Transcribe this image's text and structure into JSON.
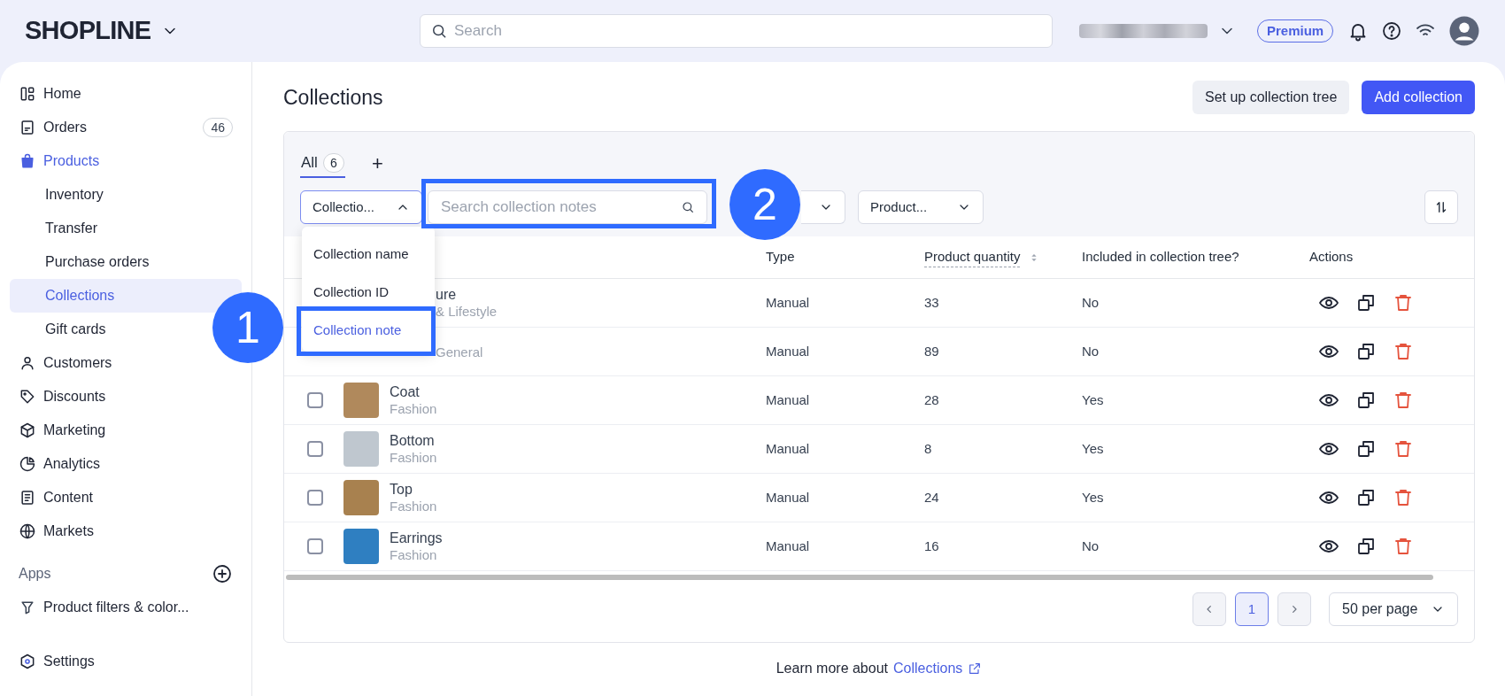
{
  "topbar": {
    "logo": "SHOPLINE",
    "search": {
      "placeholder": "Search"
    },
    "plan_badge": "Premium"
  },
  "sidebar": {
    "items": [
      {
        "label": "Home",
        "selected": false
      },
      {
        "label": "Orders",
        "selected": false,
        "badge": "46"
      },
      {
        "label": "Products",
        "selected": false,
        "expanded": true,
        "children": [
          {
            "label": "Inventory",
            "selected": false
          },
          {
            "label": "Transfer",
            "selected": false
          },
          {
            "label": "Purchase orders",
            "selected": false
          },
          {
            "label": "Collections",
            "selected": true
          },
          {
            "label": "Gift cards",
            "selected": false
          }
        ]
      },
      {
        "label": "Customers",
        "selected": false
      },
      {
        "label": "Discounts",
        "selected": false
      },
      {
        "label": "Marketing",
        "selected": false
      },
      {
        "label": "Analytics",
        "selected": false
      },
      {
        "label": "Content",
        "selected": false
      },
      {
        "label": "Markets",
        "selected": false
      }
    ],
    "apps_heading": "Apps",
    "apps": [
      {
        "label": "Product filters & color..."
      }
    ],
    "settings": "Settings"
  },
  "page": {
    "title": "Collections",
    "buttons": [
      {
        "label": "Set up collection tree",
        "kind": "secondary"
      },
      {
        "label": "Add collection",
        "kind": "primary"
      }
    ]
  },
  "tabs": [
    {
      "label": "All",
      "count": "6",
      "selected": true
    }
  ],
  "add_tab": "+",
  "filters": {
    "field_select": {
      "value": "Collectio...",
      "expanded": true
    },
    "search": {
      "placeholder": "Search collection notes"
    },
    "dropdowns": [
      {
        "label": "Product..."
      }
    ]
  },
  "field_menu": [
    {
      "label": "Collection name",
      "selected": false
    },
    {
      "label": "Collection ID",
      "selected": false
    },
    {
      "label": "Collection note",
      "selected": true
    }
  ],
  "table": {
    "columns": [
      "Type",
      "Product quantity",
      "Included in collection tree?",
      "Actions"
    ],
    "rows": [
      {
        "kind": "covered",
        "name": "ure",
        "category": "& Lifestyle",
        "type": "Manual",
        "quantity": "33",
        "included": "No"
      },
      {
        "kind": "covered",
        "category": "General",
        "type": "Manual",
        "quantity": "89",
        "included": "No"
      },
      {
        "kind": "item",
        "checked": false,
        "name": "Coat",
        "category": "Fashion",
        "type": "Manual",
        "quantity": "28",
        "included": "Yes"
      },
      {
        "kind": "item",
        "checked": false,
        "name": "Bottom",
        "category": "Fashion",
        "type": "Manual",
        "quantity": "8",
        "included": "Yes"
      },
      {
        "kind": "item",
        "checked": false,
        "name": "Top",
        "category": "Fashion",
        "type": "Manual",
        "quantity": "24",
        "included": "Yes"
      },
      {
        "kind": "item",
        "checked": false,
        "name": "Earrings",
        "category": "Fashion",
        "type": "Manual",
        "quantity": "16",
        "included": "No"
      }
    ]
  },
  "pagination": {
    "pages": [
      {
        "label": "1",
        "selected": true
      }
    ],
    "per_page": "50 per page"
  },
  "footer": {
    "text": "Learn more about",
    "link": "Collections"
  },
  "annotations": [
    {
      "number": "1"
    },
    {
      "number": "2"
    }
  ]
}
